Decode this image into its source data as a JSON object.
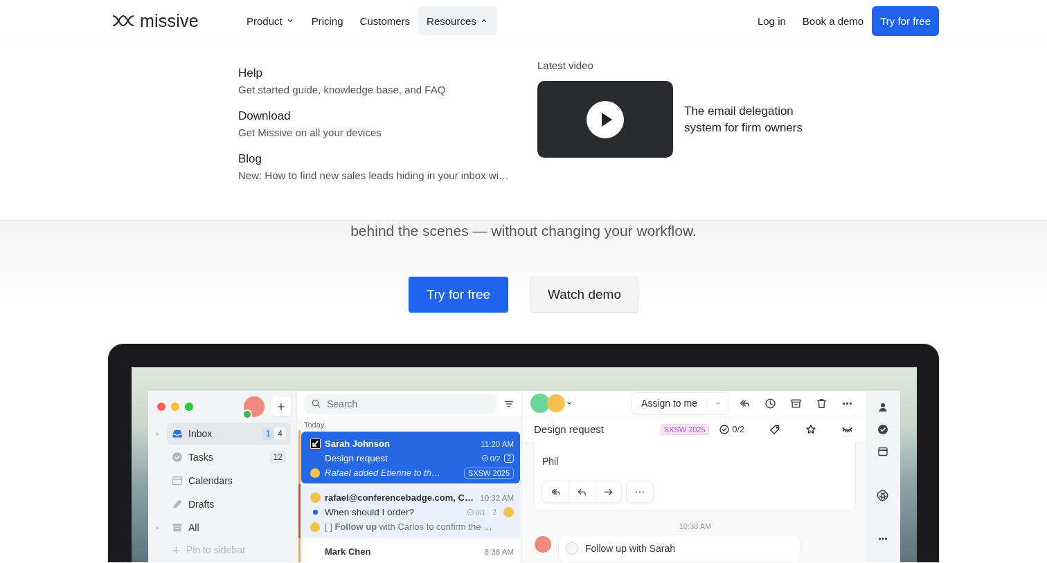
{
  "header": {
    "logo": "missive",
    "nav": [
      {
        "label": "Product",
        "expanded": false
      },
      {
        "label": "Pricing"
      },
      {
        "label": "Customers"
      },
      {
        "label": "Resources",
        "expanded": true
      }
    ],
    "actions": [
      {
        "label": "Log in",
        "kind": "link"
      },
      {
        "label": "Book a demo",
        "kind": "link"
      },
      {
        "label": "Try for free",
        "kind": "primary"
      }
    ]
  },
  "resources_menu": {
    "items": [
      {
        "title": "Help",
        "description": "Get started guide, knowledge base, and FAQ"
      },
      {
        "title": "Download",
        "description": "Get Missive on all your devices"
      },
      {
        "title": "Blog",
        "description": "New: How to find new sales leads hiding in your inbox wi…"
      }
    ],
    "latest_video": {
      "heading": "Latest video",
      "title": "The email delegation system for firm owners"
    }
  },
  "hero": {
    "subtitle": "behind the scenes — without changing your workflow.",
    "buttons": [
      {
        "label": "Try for free",
        "kind": "primary"
      },
      {
        "label": "Watch demo",
        "kind": "secondary"
      }
    ]
  },
  "app": {
    "sidebar": {
      "items": [
        {
          "label": "Inbox",
          "kind": "inbox",
          "selected": true,
          "expandable": true,
          "counts": [
            {
              "text": "1",
              "kind": "unread"
            },
            {
              "text": "4",
              "kind": "total"
            }
          ]
        },
        {
          "label": "Tasks",
          "kind": "tasks",
          "selected": false,
          "counts": [
            {
              "text": "12",
              "kind": "total"
            }
          ]
        },
        {
          "label": "Calendars",
          "kind": "calendar",
          "selected": false
        },
        {
          "label": "Drafts",
          "kind": "drafts",
          "selected": false
        },
        {
          "label": "All",
          "kind": "all",
          "selected": false,
          "expandable": true
        }
      ],
      "pin": "Pin to sidebar"
    },
    "list": {
      "search_placeholder": "Search",
      "section": "Today",
      "conversations": [
        {
          "kind": "assigned",
          "sender": "Sarah Johnson",
          "time": "11:20 AM",
          "subject": "Design request",
          "tasks": "0/2",
          "count": "2",
          "preview": "Rafael added Etienne to th…",
          "preview_italic": true,
          "label": "SXSW 2025",
          "assignee": false,
          "selected": true,
          "unread": false,
          "color": "#f0a73a"
        },
        {
          "kind": "avatar",
          "sender": "rafael@conferencebadge.com, C…",
          "time": "10:32 AM",
          "subject": "When should I order?",
          "tasks": "0/1",
          "count": "2",
          "preview": "[ ] **Follow up** with Carlos to confirm the …",
          "preview_italic": false,
          "assignee": true,
          "selected": false,
          "unread": true,
          "color": "#e0453a"
        },
        {
          "kind": "none",
          "sender": "Mark Chen",
          "time": "8:38 AM",
          "selected": false,
          "unread": false,
          "color": "#f0a73a"
        }
      ]
    },
    "conversation": {
      "assign_button": "Assign to me",
      "subject": "Design request",
      "label": "SXSW 2025",
      "tasks": "0/2",
      "signature": "Phil",
      "timestamp": "10:38 AM",
      "task": {
        "text": "Follow up with Sarah",
        "checked": false
      }
    }
  }
}
